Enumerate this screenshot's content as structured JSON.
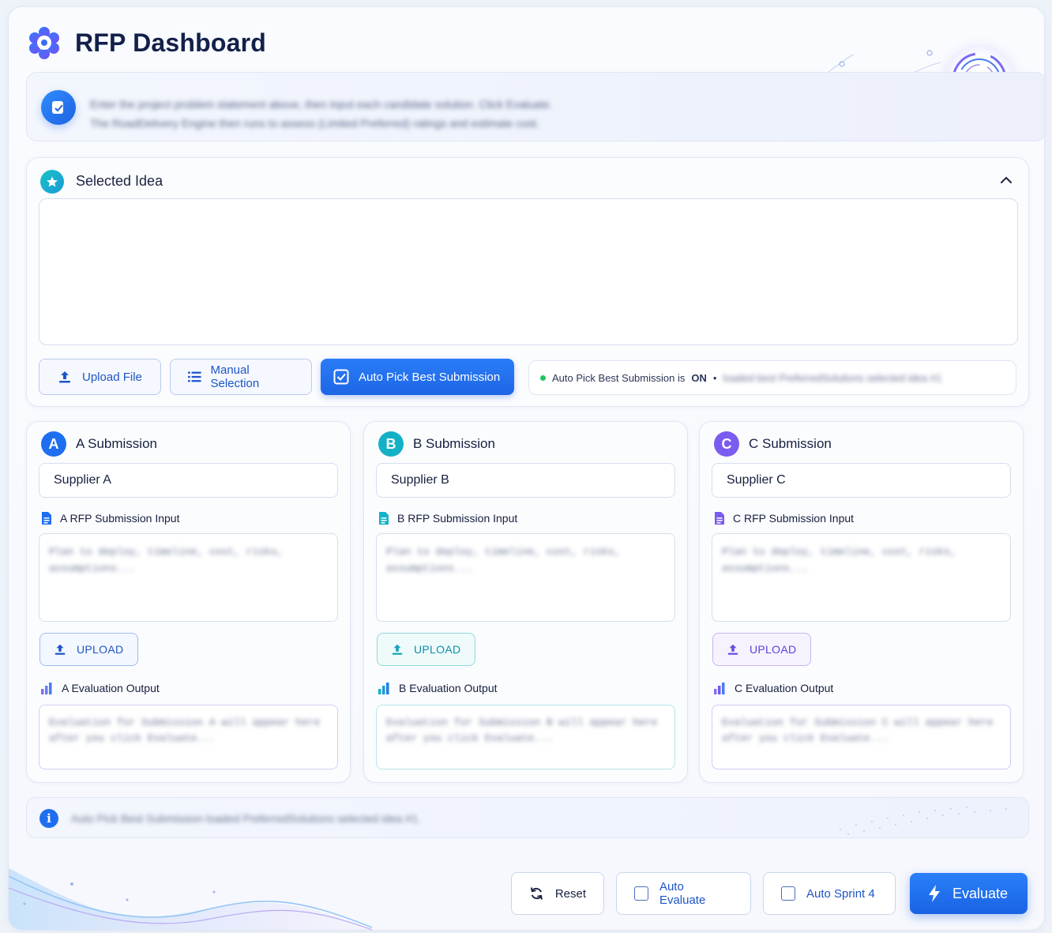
{
  "app": {
    "title": "RFP Dashboard"
  },
  "banner": {
    "line1": "Enter the project problem statement above, then input each candidate solution. Click Evaluate.",
    "line2": "The RoadDelivery Engine then runs to assess (Limited Preferred) ratings and estimate cost."
  },
  "idea": {
    "title": "Selected Idea",
    "content": "",
    "upload_label": "Upload File",
    "manual_label": "Manual Selection",
    "auto_pick_label": "Auto Pick Best Submission",
    "status_prefix": "Auto Pick Best Submission is",
    "status_state": "ON",
    "status_separator": "•",
    "status_detail": "loaded best PreferredSolutions selected idea #1"
  },
  "submissions": [
    {
      "badge": "A",
      "title": "A Submission",
      "supplier": "Supplier A",
      "input_label": "A RFP Submission Input",
      "input_placeholder": "Plan to deploy, timeline, cost, risks, assumptions...",
      "upload_label": "UPLOAD",
      "output_label": "A Evaluation Output",
      "output_placeholder": "Evaluation for Submission A will appear here after you click Evaluate..."
    },
    {
      "badge": "B",
      "title": "B Submission",
      "supplier": "Supplier B",
      "input_label": "B RFP Submission Input",
      "input_placeholder": "Plan to deploy, timeline, cost, risks, assumptions...",
      "upload_label": "UPLOAD",
      "output_label": "B Evaluation Output",
      "output_placeholder": "Evaluation for Submission B will appear here after you click Evaluate..."
    },
    {
      "badge": "C",
      "title": "C Submission",
      "supplier": "Supplier C",
      "input_label": "C RFP Submission Input",
      "input_placeholder": "Plan to deploy, timeline, cost, risks, assumptions...",
      "upload_label": "UPLOAD",
      "output_label": "C Evaluation Output",
      "output_placeholder": "Evaluation for Submission C will appear here after you click Evaluate..."
    }
  ],
  "info": {
    "message": "Auto Pick Best Submission loaded PreferredSolutions selected idea #1."
  },
  "footer": {
    "reset_label": "Reset",
    "auto_evaluate_label": "Auto Evaluate",
    "auto_sprint_label": "Auto Sprint 4",
    "evaluate_label": "Evaluate"
  },
  "colors": {
    "primary": "#1e66e6",
    "accent_a": "#1e6ff0",
    "accent_b": "#14b1c6",
    "accent_c": "#7b5cf0",
    "status_on": "#22c55e"
  }
}
